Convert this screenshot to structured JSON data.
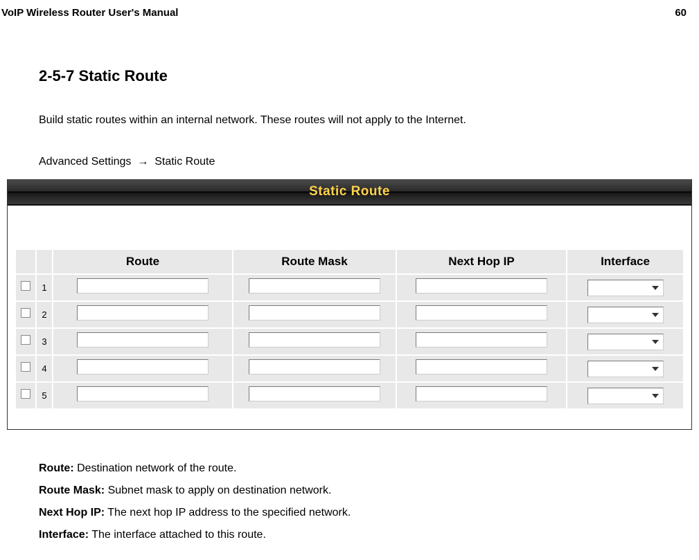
{
  "header": {
    "doc_title": "VoIP Wireless Router User's Manual",
    "page_number": "60"
  },
  "section": {
    "title": "2-5-7 Static Route",
    "intro": "Build static routes within an internal network. These routes will not apply to the Internet.",
    "breadcrumb_prefix": "Advanced Settings",
    "breadcrumb_arrow": "→",
    "breadcrumb_target": "Static Route"
  },
  "screenshot": {
    "title": "Static Route",
    "columns": {
      "route": "Route",
      "route_mask": "Route Mask",
      "next_hop": "Next Hop IP",
      "interface": "Interface"
    },
    "rows": [
      {
        "num": "1",
        "route": "",
        "mask": "",
        "nexthop": "",
        "iface": ""
      },
      {
        "num": "2",
        "route": "",
        "mask": "",
        "nexthop": "",
        "iface": ""
      },
      {
        "num": "3",
        "route": "",
        "mask": "",
        "nexthop": "",
        "iface": ""
      },
      {
        "num": "4",
        "route": "",
        "mask": "",
        "nexthop": "",
        "iface": ""
      },
      {
        "num": "5",
        "route": "",
        "mask": "",
        "nexthop": "",
        "iface": ""
      }
    ]
  },
  "definitions": {
    "route_label": "Route:",
    "route_desc": " Destination network of the route.",
    "mask_label": "Route Mask:",
    "mask_desc": " Subnet mask to apply on destination network.",
    "nh_label": "Next Hop IP:",
    "nh_desc": " The next hop IP address to the specified network.",
    "if_label": "Interface:",
    "if_desc": " The interface attached to this route."
  }
}
